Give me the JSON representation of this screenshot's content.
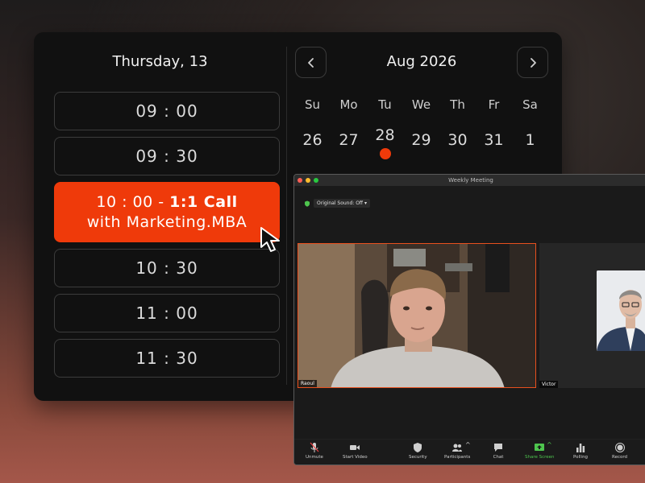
{
  "booking": {
    "day_title": "Thursday, 13",
    "slots": [
      {
        "label": "09 : 00"
      },
      {
        "label": "09 : 30"
      },
      {
        "line1_time": "10 : 00 - ",
        "line1_bold": "1:1 Call",
        "line2": "with Marketing.MBA"
      },
      {
        "label": "10 : 30"
      },
      {
        "label": "11 : 00"
      },
      {
        "label": "11 : 30"
      }
    ],
    "calendar": {
      "month_label": "Aug 2026",
      "weekdays": [
        "Su",
        "Mo",
        "Tu",
        "We",
        "Th",
        "Fr",
        "Sa"
      ],
      "dates": [
        "26",
        "27",
        "28",
        "29",
        "30",
        "31",
        "1"
      ],
      "marked_date": "28",
      "prev_icon": "chevron-left-icon",
      "next_icon": "chevron-right-icon"
    },
    "accent_color": "#ef3a0a"
  },
  "zoom": {
    "window_title": "Weekly Meeting",
    "original_sound": "Original Sound: Off",
    "participants": [
      {
        "name": "Raoul"
      },
      {
        "name": "Victor"
      }
    ],
    "toolbar": {
      "unmute": "Unmute",
      "start_video": "Start Video",
      "security": "Security",
      "participants": "Participants",
      "chat": "Chat",
      "share_screen": "Share Screen",
      "polling": "Polling",
      "record": "Record"
    },
    "active_speaker_color": "#e8501e",
    "share_color": "#4ec54e"
  }
}
